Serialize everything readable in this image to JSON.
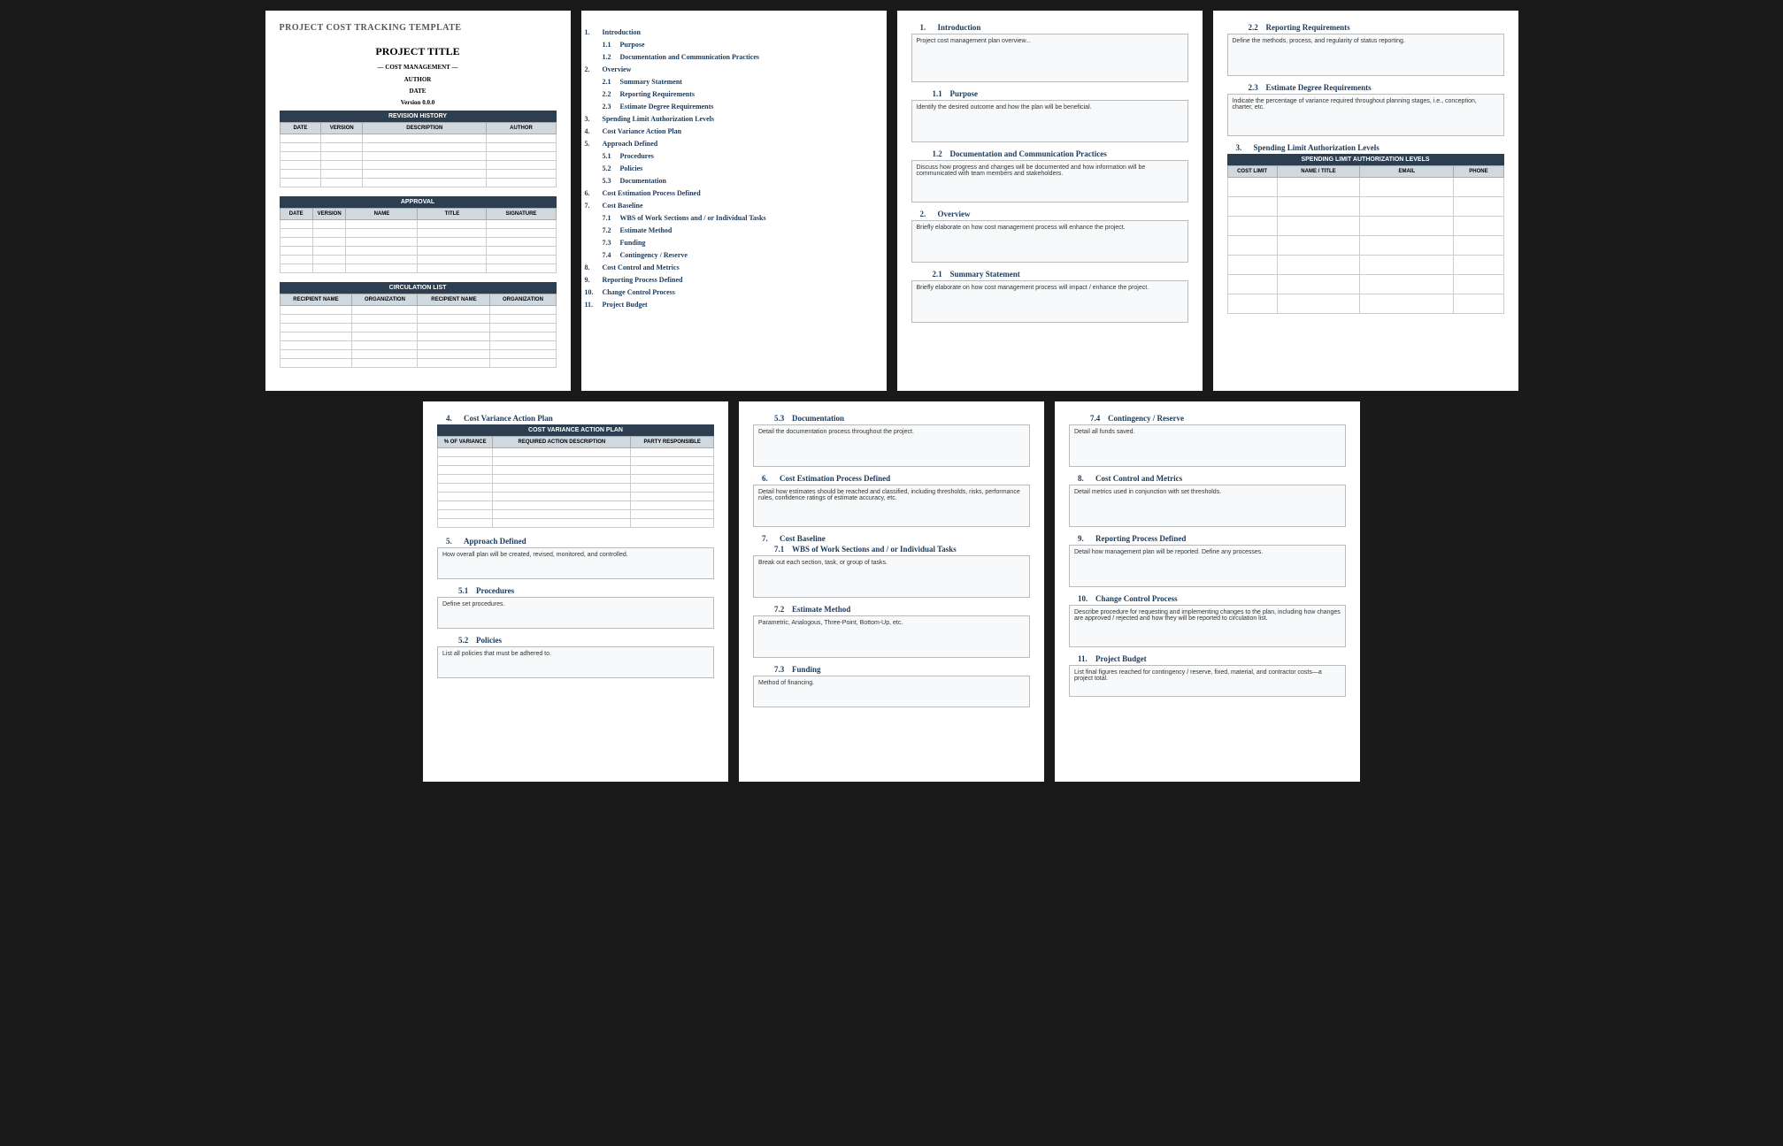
{
  "doc_title": "PROJECT COST TRACKING TEMPLATE",
  "cover": {
    "project_title": "PROJECT TITLE",
    "subtitle": "—   COST MANAGEMENT   —",
    "author": "AUTHOR",
    "date": "DATE",
    "version": "Version 0.0.0"
  },
  "tables": {
    "revision": {
      "caption": "REVISION HISTORY",
      "cols": [
        "DATE",
        "VERSION",
        "DESCRIPTION",
        "AUTHOR"
      ]
    },
    "approval": {
      "caption": "APPROVAL",
      "cols": [
        "DATE",
        "VERSION",
        "NAME",
        "TITLE",
        "SIGNATURE"
      ]
    },
    "circulation": {
      "caption": "CIRCULATION LIST",
      "cols": [
        "RECIPIENT NAME",
        "ORGANIZATION",
        "RECIPIENT NAME",
        "ORGANIZATION"
      ]
    },
    "variance": {
      "caption": "COST VARIANCE ACTION PLAN",
      "cols": [
        "% OF VARIANCE",
        "REQUIRED ACTION DESCRIPTION",
        "PARTY RESPONSIBLE"
      ]
    },
    "spending": {
      "caption": "SPENDING LIMIT AUTHORIZATION LEVELS",
      "cols": [
        "COST LIMIT",
        "NAME / TITLE",
        "EMAIL",
        "PHONE"
      ]
    }
  },
  "toc": [
    {
      "n": "1.",
      "t": "Introduction",
      "sub": false
    },
    {
      "n": "1.1",
      "t": "Purpose",
      "sub": true
    },
    {
      "n": "1.2",
      "t": "Documentation and Communication Practices",
      "sub": true
    },
    {
      "n": "2.",
      "t": "Overview",
      "sub": false
    },
    {
      "n": "2.1",
      "t": "Summary Statement",
      "sub": true
    },
    {
      "n": "2.2",
      "t": "Reporting Requirements",
      "sub": true
    },
    {
      "n": "2.3",
      "t": "Estimate Degree Requirements",
      "sub": true
    },
    {
      "n": "3.",
      "t": "Spending Limit Authorization Levels",
      "sub": false
    },
    {
      "n": "4.",
      "t": "Cost Variance Action Plan",
      "sub": false
    },
    {
      "n": "5.",
      "t": "Approach Defined",
      "sub": false
    },
    {
      "n": "5.1",
      "t": "Procedures",
      "sub": true
    },
    {
      "n": "5.2",
      "t": "Policies",
      "sub": true
    },
    {
      "n": "5.3",
      "t": "Documentation",
      "sub": true
    },
    {
      "n": "6.",
      "t": "Cost Estimation Process Defined",
      "sub": false
    },
    {
      "n": "7.",
      "t": "Cost Baseline",
      "sub": false
    },
    {
      "n": "7.1",
      "t": "WBS of Work Sections and / or Individual Tasks",
      "sub": true
    },
    {
      "n": "7.2",
      "t": "Estimate Method",
      "sub": true
    },
    {
      "n": "7.3",
      "t": "Funding",
      "sub": true
    },
    {
      "n": "7.4",
      "t": "Contingency / Reserve",
      "sub": true
    },
    {
      "n": "8.",
      "t": "Cost Control and Metrics",
      "sub": false
    },
    {
      "n": "9.",
      "t": "Reporting Process Defined",
      "sub": false
    },
    {
      "n": "10.",
      "t": "Change Control Process",
      "sub": false
    },
    {
      "n": "11.",
      "t": "Project Budget",
      "sub": false
    }
  ],
  "sections": {
    "s1": {
      "n": "1.",
      "t": "Introduction",
      "d": "Project cost management plan overview..."
    },
    "s1_1": {
      "n": "1.1",
      "t": "Purpose",
      "d": "Identify the desired outcome and how the plan will be beneficial."
    },
    "s1_2": {
      "n": "1.2",
      "t": "Documentation and Communication Practices",
      "d": "Discuss how progress and changes will be documented and how information will be communicated with team members and stakeholders."
    },
    "s2": {
      "n": "2.",
      "t": "Overview",
      "d": "Briefly elaborate on how cost management process will enhance the project."
    },
    "s2_1": {
      "n": "2.1",
      "t": "Summary Statement",
      "d": "Briefly elaborate on how cost management process will impact / enhance the project."
    },
    "s2_2": {
      "n": "2.2",
      "t": "Reporting Requirements",
      "d": "Define the methods, process, and regularity of status reporting."
    },
    "s2_3": {
      "n": "2.3",
      "t": "Estimate Degree Requirements",
      "d": "Indicate the percentage of variance required throughout planning stages, i.e., conception, charter, etc."
    },
    "s3": {
      "n": "3.",
      "t": "Spending Limit Authorization Levels"
    },
    "s4": {
      "n": "4.",
      "t": "Cost Variance Action Plan"
    },
    "s5": {
      "n": "5.",
      "t": "Approach Defined",
      "d": "How overall plan will be created, revised, monitored, and controlled."
    },
    "s5_1": {
      "n": "5.1",
      "t": "Procedures",
      "d": "Define set procedures."
    },
    "s5_2": {
      "n": "5.2",
      "t": "Policies",
      "d": "List all policies that must be adhered to."
    },
    "s5_3": {
      "n": "5.3",
      "t": "Documentation",
      "d": "Detail the documentation process throughout the project."
    },
    "s6": {
      "n": "6.",
      "t": "Cost Estimation Process Defined",
      "d": "Detail how estimates should be reached and classified, including thresholds, risks, performance rules, confidence ratings of estimate accuracy, etc."
    },
    "s7": {
      "n": "7.",
      "t": "Cost Baseline"
    },
    "s7_1": {
      "n": "7.1",
      "t": "WBS of Work Sections and / or Individual Tasks",
      "d": "Break out each section, task, or group of tasks."
    },
    "s7_2": {
      "n": "7.2",
      "t": "Estimate Method",
      "d": "Parametric, Analogous, Three-Point, Bottom-Up, etc."
    },
    "s7_3": {
      "n": "7.3",
      "t": "Funding",
      "d": "Method of financing."
    },
    "s7_4": {
      "n": "7.4",
      "t": "Contingency / Reserve",
      "d": "Detail all funds saved."
    },
    "s8": {
      "n": "8.",
      "t": "Cost Control and Metrics",
      "d": "Detail metrics used in conjunction with set thresholds."
    },
    "s9": {
      "n": "9.",
      "t": "Reporting Process Defined",
      "d": "Detail how management plan will be reported. Define any processes."
    },
    "s10": {
      "n": "10.",
      "t": "Change Control Process",
      "d": "Describe procedure for requesting and implementing changes to the plan, including how changes are approved / rejected and how they will be reported to circulation list."
    },
    "s11": {
      "n": "11.",
      "t": "Project Budget",
      "d": "List final figures reached for contingency / reserve, fixed, material, and contractor costs—a project total."
    }
  }
}
